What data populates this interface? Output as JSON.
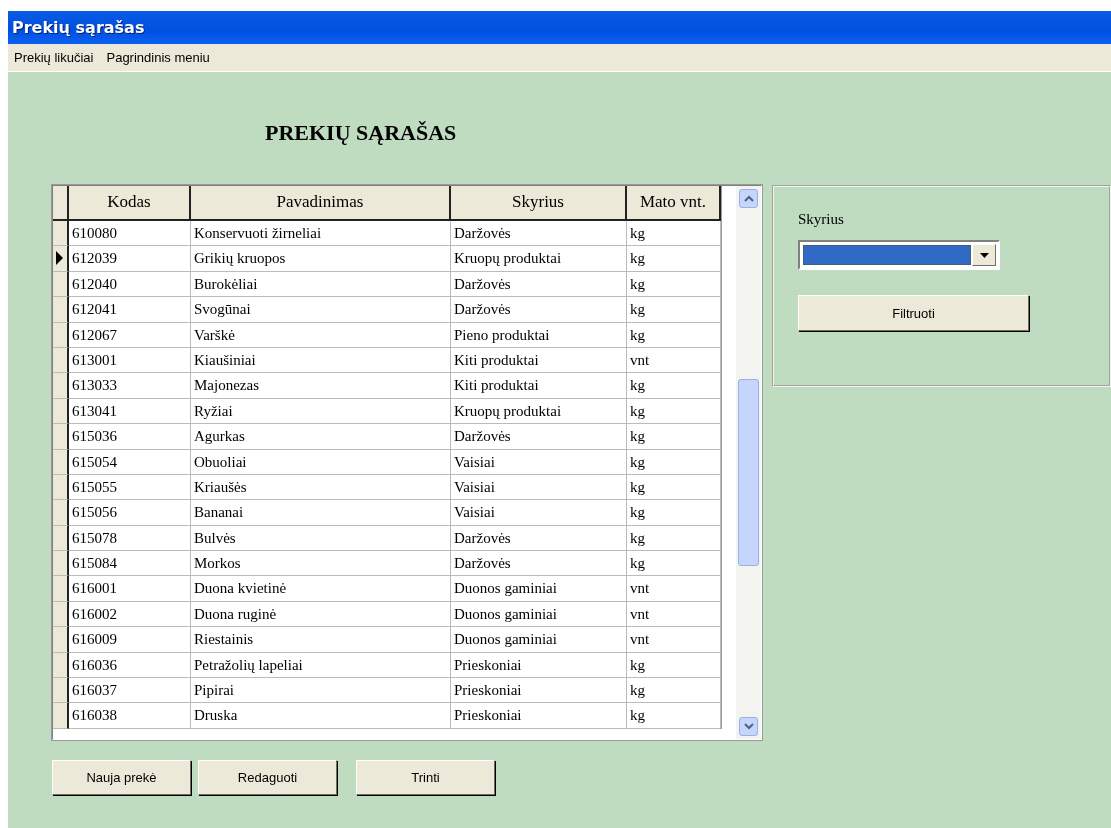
{
  "window": {
    "title": "Prekių sąrašas"
  },
  "menu": [
    "Prekių likučiai",
    "Pagrindinis meniu"
  ],
  "heading": "PREKIŲ SĄRAŠAS",
  "table": {
    "columns": [
      "Kodas",
      "Pavadinimas",
      "Skyrius",
      "Mato vnt."
    ],
    "rows": [
      {
        "cells": [
          "610080",
          "Konservuoti žirneliai",
          "Daržovės",
          "kg"
        ],
        "selected": false
      },
      {
        "cells": [
          "612039",
          "Grikių kruopos",
          "Kruopų produktai",
          "kg"
        ],
        "selected": true
      },
      {
        "cells": [
          "612040",
          "Burokėliai",
          "Daržovės",
          "kg"
        ],
        "selected": false
      },
      {
        "cells": [
          "612041",
          "Svogūnai",
          "Daržovės",
          "kg"
        ],
        "selected": false
      },
      {
        "cells": [
          "612067",
          "Varškė",
          "Pieno produktai",
          "kg"
        ],
        "selected": false
      },
      {
        "cells": [
          "613001",
          "Kiaušiniai",
          "Kiti produktai",
          "vnt"
        ],
        "selected": false
      },
      {
        "cells": [
          "613033",
          "Majonezas",
          "Kiti produktai",
          "kg"
        ],
        "selected": false
      },
      {
        "cells": [
          "613041",
          "Ryžiai",
          "Kruopų produktai",
          "kg"
        ],
        "selected": false
      },
      {
        "cells": [
          "615036",
          "Agurkas",
          "Daržovės",
          "kg"
        ],
        "selected": false
      },
      {
        "cells": [
          "615054",
          "Obuoliai",
          "Vaisiai",
          "kg"
        ],
        "selected": false
      },
      {
        "cells": [
          "615055",
          "Kriaušės",
          "Vaisiai",
          "kg"
        ],
        "selected": false
      },
      {
        "cells": [
          "615056",
          "Bananai",
          "Vaisiai",
          "kg"
        ],
        "selected": false
      },
      {
        "cells": [
          "615078",
          "Bulvės",
          "Daržovės",
          "kg"
        ],
        "selected": false
      },
      {
        "cells": [
          "615084",
          "Morkos",
          "Daržovės",
          "kg"
        ],
        "selected": false
      },
      {
        "cells": [
          "616001",
          "Duona kvietinė",
          "Duonos gaminiai",
          "vnt"
        ],
        "selected": false
      },
      {
        "cells": [
          "616002",
          "Duona ruginė",
          "Duonos gaminiai",
          "vnt"
        ],
        "selected": false
      },
      {
        "cells": [
          "616009",
          "Riestainis",
          "Duonos gaminiai",
          "vnt"
        ],
        "selected": false
      },
      {
        "cells": [
          "616036",
          "Petražolių lapeliai",
          "Prieskoniai",
          "kg"
        ],
        "selected": false
      },
      {
        "cells": [
          "616037",
          "Pipirai",
          "Prieskoniai",
          "kg"
        ],
        "selected": false
      },
      {
        "cells": [
          "616038",
          "Druska",
          "Prieskoniai",
          "kg"
        ],
        "selected": false
      }
    ]
  },
  "filter": {
    "label": "Skyrius",
    "combo": {
      "focused": true
    },
    "button": "Filtruoti"
  },
  "buttons": [
    "Nauja prekė",
    "Redaguoti",
    "Trinti"
  ]
}
